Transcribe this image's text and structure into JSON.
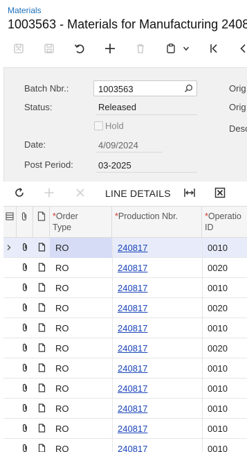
{
  "header": {
    "breadcrumb": "Materials",
    "title": "1003563 - Materials for Manufacturing 2408"
  },
  "toolbar": {
    "icons": [
      "save-draft-icon",
      "save-icon",
      "undo-icon",
      "add-icon",
      "delete-icon",
      "copy-paste-icon",
      "chevron-down-icon",
      "first-record-icon",
      "previous-record-icon"
    ]
  },
  "form": {
    "batch_nbr_label": "Batch Nbr.:",
    "batch_nbr_value": "1003563",
    "status_label": "Status:",
    "status_value": "Released",
    "hold_label": "Hold",
    "hold_checked": false,
    "date_label": "Date:",
    "date_value": "4/09/2024",
    "post_period_label": "Post Period:",
    "post_period_value": "03-2025",
    "right_labels": [
      "Orig",
      "Orig",
      "Desc"
    ]
  },
  "grid_toolbar": {
    "line_details_label": "LINE DETAILS",
    "icons": [
      "refresh-icon",
      "add-row-icon",
      "delete-row-icon",
      "fit-columns-icon",
      "export-excel-icon"
    ]
  },
  "grid": {
    "columns": [
      {
        "required": true,
        "line1": "Order",
        "line2": "Type"
      },
      {
        "required": true,
        "line1": "Production Nbr.",
        "line2": ""
      },
      {
        "required": true,
        "line1": "Operatio",
        "line2": "ID"
      }
    ],
    "rows": [
      {
        "order_type": "RO",
        "production_nbr": "240817",
        "operation_id": "0010"
      },
      {
        "order_type": "RO",
        "production_nbr": "240817",
        "operation_id": "0020"
      },
      {
        "order_type": "RO",
        "production_nbr": "240817",
        "operation_id": "0010"
      },
      {
        "order_type": "RO",
        "production_nbr": "240817",
        "operation_id": "0020"
      },
      {
        "order_type": "RO",
        "production_nbr": "240817",
        "operation_id": "0010"
      },
      {
        "order_type": "RO",
        "production_nbr": "240817",
        "operation_id": "0020"
      },
      {
        "order_type": "RO",
        "production_nbr": "240817",
        "operation_id": "0010"
      },
      {
        "order_type": "RO",
        "production_nbr": "240817",
        "operation_id": "0010"
      },
      {
        "order_type": "RO",
        "production_nbr": "240817",
        "operation_id": "0010"
      },
      {
        "order_type": "RO",
        "production_nbr": "240817",
        "operation_id": "0010"
      },
      {
        "order_type": "RO",
        "production_nbr": "240817",
        "operation_id": "0010"
      }
    ]
  },
  "colors": {
    "link": "#1a44b8",
    "breadcrumb": "#1d6fb8",
    "required": "#d0342c",
    "active_row": "#e8ecfa"
  }
}
